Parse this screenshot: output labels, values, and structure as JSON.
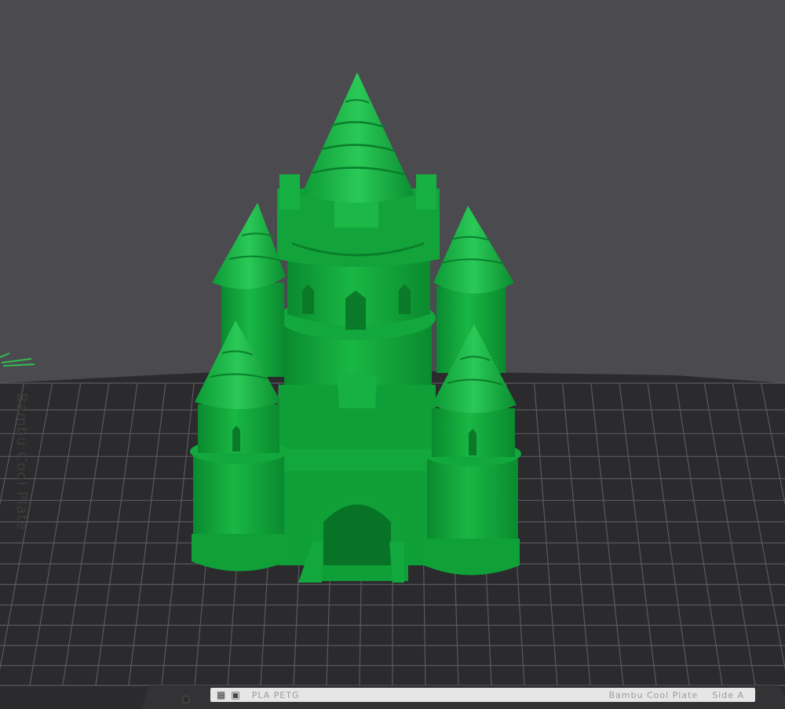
{
  "app": {
    "view": "3D Prepare / Preview",
    "background_color": "#4a4a4f"
  },
  "build_plate": {
    "name_print": "Bambu Cool Plate",
    "color": "#2b2b2d",
    "grid_color": "#5a5a5e",
    "label": {
      "material_text": "PLA  PETG",
      "plate_type_text": "Bambu Cool Plate",
      "side_text": "Side A",
      "icon_names": [
        "grid-icon",
        "plate-icon"
      ]
    }
  },
  "model": {
    "subject": "castle",
    "color": "#0fa83a",
    "shade_color": "#0a8a2f",
    "highlight_color": "#3fd26a"
  },
  "axis_gizmo": {
    "color": "#2fbf4f"
  }
}
